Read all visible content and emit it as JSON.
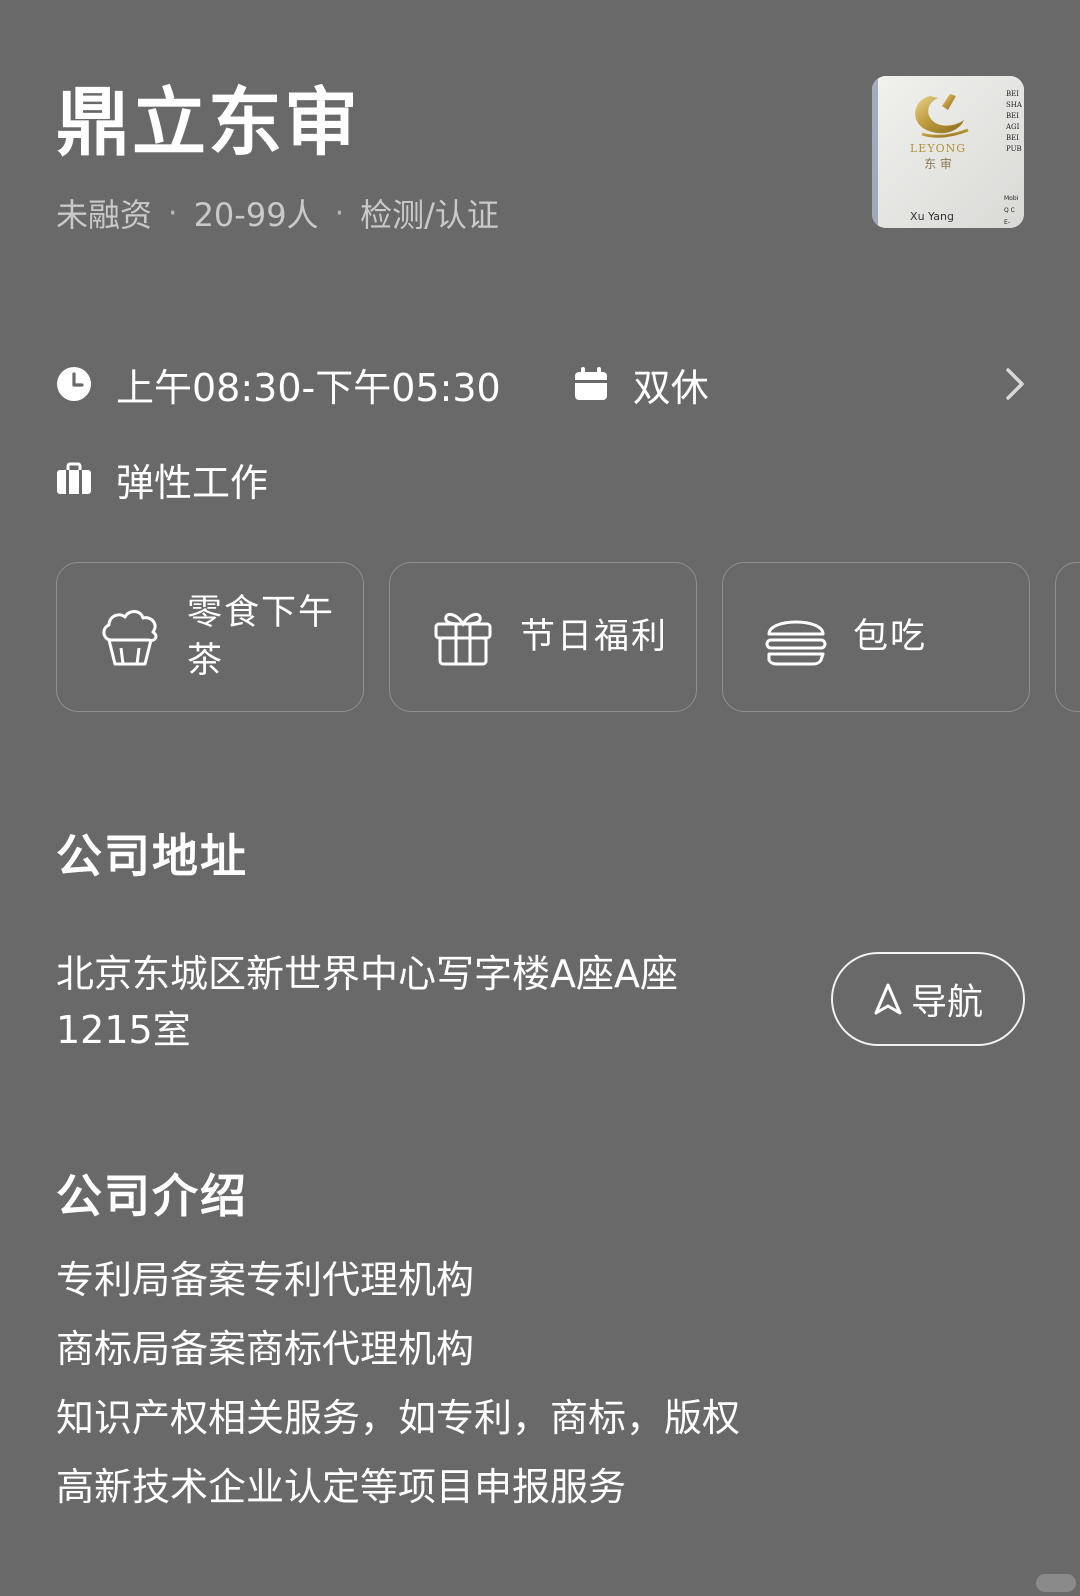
{
  "company": {
    "name": "鼎立东审",
    "meta": [
      "未融资",
      "20-99人",
      "检测/认证"
    ],
    "logo": {
      "brand_text": "LEYONG",
      "cn_text": "东  审",
      "person": "Xu Yang",
      "side_lines": [
        "BEI",
        "SHA",
        "BEI",
        "AGI",
        "BEI",
        "PUB"
      ],
      "small_lines": [
        "Mobi",
        "Q  C",
        "E-"
      ]
    }
  },
  "work_info": {
    "hours": "上午08:30-下午05:30",
    "rest": "双休",
    "mode": "弹性工作"
  },
  "welfare": [
    {
      "icon": "cupcake-icon",
      "label": "零食下午茶"
    },
    {
      "icon": "gift-icon",
      "label": "节日福利"
    },
    {
      "icon": "burger-icon",
      "label": "包吃"
    }
  ],
  "address": {
    "title": "公司地址",
    "text": "北京东城区新世界中心写字楼A座A座1215室",
    "nav_label": "导航"
  },
  "intro": {
    "title": "公司介绍",
    "lines": [
      "专利局备案专利代理机构",
      "商标局备案商标代理机构",
      "知识产权相关服务，如专利，商标，版权",
      "高新技术企业认定等项目申报服务"
    ]
  },
  "colors": {
    "background": "#696969",
    "text": "#ffffff",
    "muted": "#c9c9c9",
    "card_border": "#8f8f8f"
  }
}
